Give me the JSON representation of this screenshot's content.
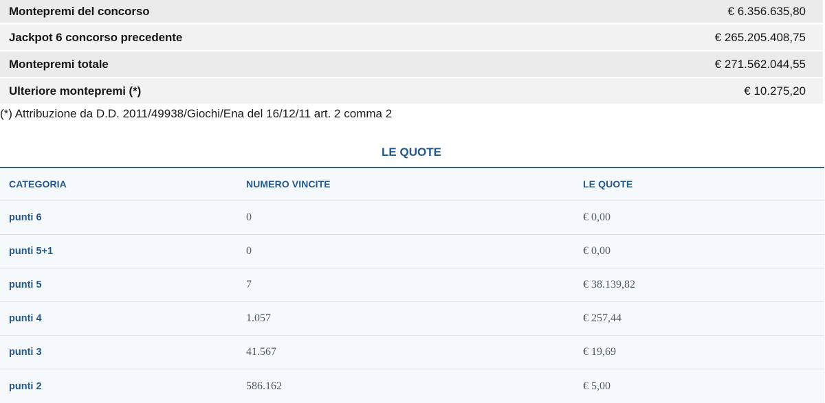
{
  "summary": {
    "rows": [
      {
        "label": "Montepremi del concorso",
        "value": "€ 6.356.635,80"
      },
      {
        "label": "Jackpot 6 concorso precedente",
        "value": "€ 265.205.408,75"
      },
      {
        "label": "Montepremi totale",
        "value": "€ 271.562.044,55"
      },
      {
        "label": "Ulteriore montepremi (*)",
        "value": "€ 10.275,20"
      }
    ],
    "note": "(*) Attribuzione da D.D. 2011/49938/Giochi/Ena del 16/12/11 art. 2 comma 2"
  },
  "quote": {
    "title": "LE QUOTE",
    "headers": {
      "category": "CATEGORIA",
      "wins": "NUMERO VINCITE",
      "quota": "LE QUOTE"
    },
    "rows": [
      {
        "category": "punti 6",
        "wins": "0",
        "quota": "€ 0,00"
      },
      {
        "category": "punti 5+1",
        "wins": "0",
        "quota": "€ 0,00"
      },
      {
        "category": "punti 5",
        "wins": "7",
        "quota": "€ 38.139,82"
      },
      {
        "category": "punti 4",
        "wins": "1.057",
        "quota": "€ 257,44"
      },
      {
        "category": "punti 3",
        "wins": "41.567",
        "quota": "€ 19,69"
      },
      {
        "category": "punti 2",
        "wins": "586.162",
        "quota": "€ 5,00"
      }
    ]
  },
  "colors": {
    "accent": "#24588a",
    "row_bg": "#f2f2f2",
    "table_bg": "#f6f9fc"
  }
}
